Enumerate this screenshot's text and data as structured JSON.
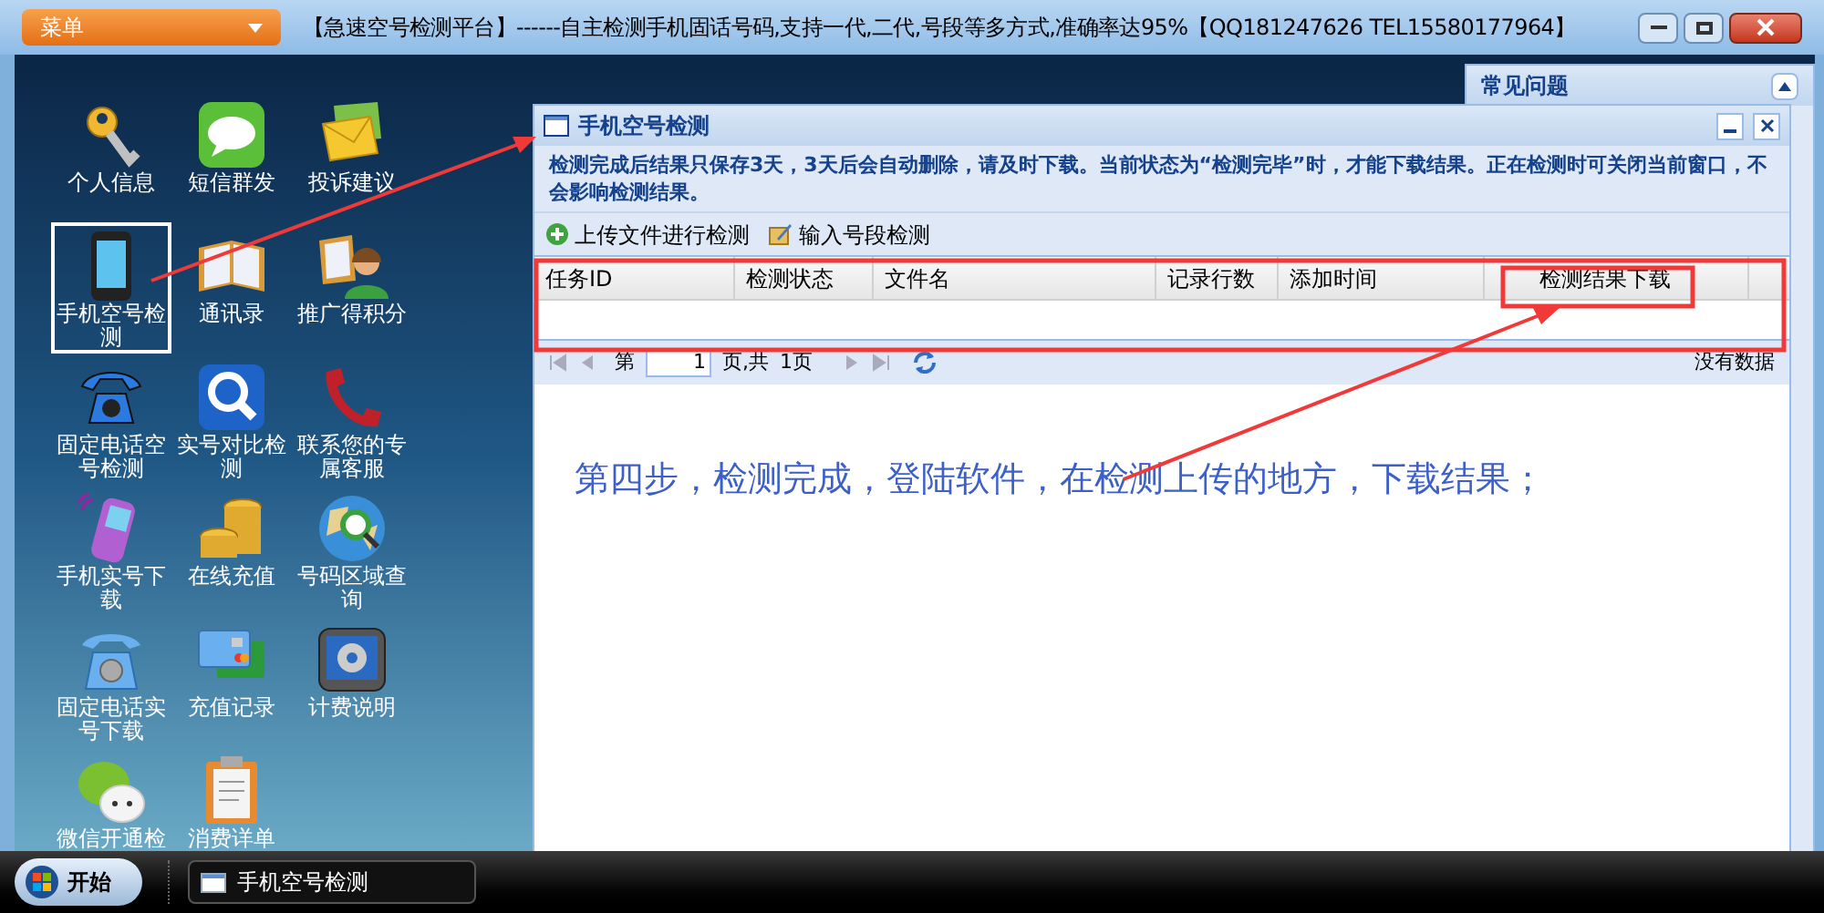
{
  "title_bar": {
    "menu_button": "菜单",
    "title": "【急速空号检测平台】------自主检测手机固话号码,支持一代,二代,号段等多方式,准确率达95%【QQ181247626  TEL15580177964】"
  },
  "desktop_icons": [
    {
      "label": "个人信息",
      "selected": false
    },
    {
      "label": "短信群发",
      "selected": false
    },
    {
      "label": "投诉建议",
      "selected": false
    },
    {
      "label": "手机空号检测",
      "selected": true
    },
    {
      "label": "通讯录",
      "selected": false
    },
    {
      "label": "推广得积分",
      "selected": false
    },
    {
      "label": "固定电话空号检测",
      "selected": false
    },
    {
      "label": "实号对比检测",
      "selected": false
    },
    {
      "label": "联系您的专属客服",
      "selected": false
    },
    {
      "label": "手机实号下载",
      "selected": false
    },
    {
      "label": "在线充值",
      "selected": false
    },
    {
      "label": "号码区域查询",
      "selected": false
    },
    {
      "label": "固定电话实号下载",
      "selected": false
    },
    {
      "label": "充值记录",
      "selected": false
    },
    {
      "label": "计费说明",
      "selected": false
    },
    {
      "label": "微信开通检",
      "selected": false
    },
    {
      "label": "消费详单",
      "selected": false
    }
  ],
  "side_panel": {
    "title": "常见问题"
  },
  "window": {
    "title": "手机空号检测",
    "notice": "检测完成后结果只保存3天，3天后会自动删除，请及时下载。当前状态为“检测完毕”时，才能下载结果。正在检测时可关闭当前窗口，不会影响检测结果。",
    "toolbar": [
      "上传文件进行检测",
      "输入号段检测"
    ],
    "table": {
      "columns": [
        "任务ID",
        "检测状态",
        "文件名",
        "记录行数",
        "添加时间",
        "检测结果下载"
      ]
    },
    "pager": {
      "page_prefix": "第",
      "page": "1",
      "page_suffix": "页,共",
      "total": "1页",
      "status": "没有数据"
    },
    "annotation": "第四步，检测完成，登陆软件，在检测上传的地方，下载结果；"
  },
  "taskbar": {
    "start": "开始",
    "tasks": [
      "手机空号检测"
    ]
  }
}
